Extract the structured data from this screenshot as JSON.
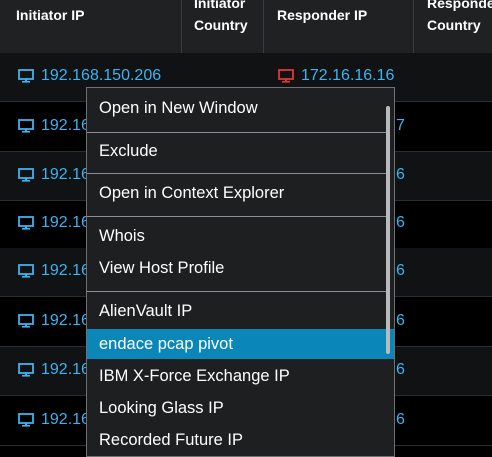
{
  "table": {
    "columns": [
      {
        "line1": "Initiator IP",
        "line2": ""
      },
      {
        "line1": "Initiator",
        "line2": "Country"
      },
      {
        "line1": "Responder IP",
        "line2": ""
      },
      {
        "line1": "Responder",
        "line2": "Country"
      }
    ],
    "rows": [
      {
        "initiator_ip": "192.168.150.206",
        "responder_ip": "172.16.16.16",
        "responder_status": "red"
      },
      {
        "initiator_ip": "192.16",
        "responder_tail": "7"
      },
      {
        "initiator_ip": "192.16",
        "responder_tail": "6"
      },
      {
        "initiator_ip": "192.16",
        "responder_tail": "6"
      },
      {
        "initiator_ip": "192.16",
        "responder_tail": "6"
      },
      {
        "initiator_ip": "192.16",
        "responder_tail": "6"
      },
      {
        "initiator_ip": "192.16",
        "responder_tail": "6"
      },
      {
        "initiator_ip": "192.16",
        "responder_tail": "6"
      }
    ]
  },
  "context_menu": {
    "items": [
      "Open in New Window",
      "Exclude",
      "Open in Context Explorer",
      "Whois",
      "View Host Profile",
      "AlienVault IP",
      "endace pcap pivot",
      "IBM X-Force Exchange IP",
      "Looking Glass IP",
      "Recorded Future IP"
    ],
    "active_item": "endace pcap pivot"
  },
  "colors": {
    "link_blue": "#3ab4f2",
    "alert_red": "#e0363b",
    "highlight": "#0a87b8",
    "header_bg": "#1f2123",
    "menu_bg": "#1e1f21"
  },
  "icons": {
    "host": "monitor-icon"
  }
}
